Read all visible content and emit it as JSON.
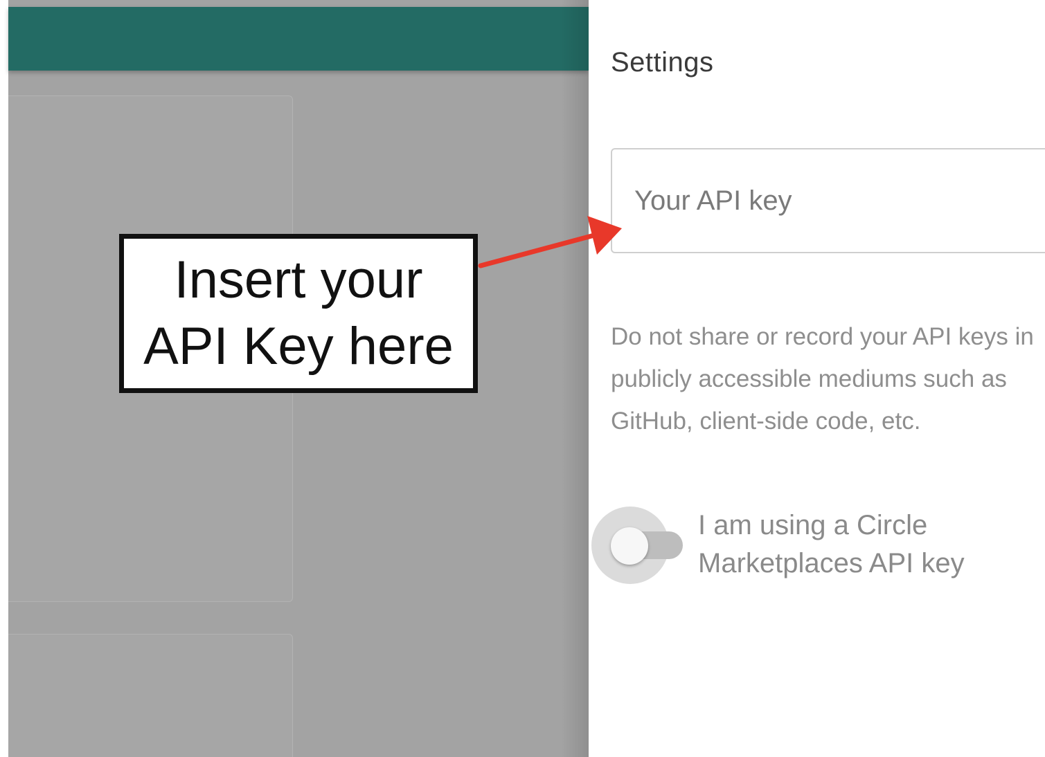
{
  "settings": {
    "title": "Settings",
    "api_key_placeholder": "Your API key",
    "api_key_value": "",
    "warning": "Do not share or record your API keys in publicly accessible mediums such as GitHub, client-side code, etc.",
    "marketplaces_toggle": {
      "label": "I am using a Circle Marketplaces API key",
      "on": false
    }
  },
  "annotation": {
    "line1": "Insert your",
    "line2": "API Key here"
  },
  "colors": {
    "header": "#236b64",
    "overlay": "#a3a3a3",
    "arrow": "#e8382a"
  }
}
